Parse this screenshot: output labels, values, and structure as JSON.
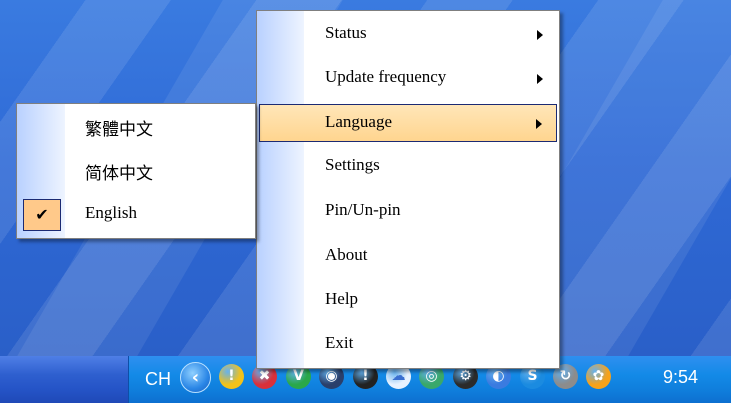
{
  "main_menu": {
    "items": [
      {
        "label": "Status",
        "has_submenu": true
      },
      {
        "label": "Update frequency",
        "has_submenu": true
      },
      {
        "label": "Language",
        "has_submenu": true,
        "highlighted": true
      },
      {
        "label": "Settings",
        "has_submenu": false
      },
      {
        "label": "Pin/Un-pin",
        "has_submenu": false
      },
      {
        "label": "About",
        "has_submenu": false
      },
      {
        "label": "Help",
        "has_submenu": false
      },
      {
        "label": "Exit",
        "has_submenu": false
      }
    ]
  },
  "language_menu": {
    "items": [
      {
        "label": "繁體中文",
        "checked": false
      },
      {
        "label": "简体中文",
        "checked": false
      },
      {
        "label": "English",
        "checked": true
      }
    ],
    "check_glyph": "✔"
  },
  "taskbar": {
    "language_indicator": "CH",
    "expand_arrow": "‹",
    "clock": "9:54",
    "tray_icons": [
      {
        "name": "shield-icon",
        "glyph": "!",
        "color": "#f2c21a"
      },
      {
        "name": "security-alert-icon",
        "glyph": "✖",
        "color": "#d9303a"
      },
      {
        "name": "vc-app-icon",
        "glyph": "V",
        "color": "#2aa84a"
      },
      {
        "name": "network-globe-icon",
        "glyph": "◉",
        "color": "#2a3f6b"
      },
      {
        "name": "info-icon",
        "glyph": "!",
        "color": "#222222"
      },
      {
        "name": "cloud-icon",
        "glyph": "☁",
        "color": "#e8f2ff"
      },
      {
        "name": "green-circle-icon",
        "glyph": "◎",
        "color": "#39a86a"
      },
      {
        "name": "gear-app-icon",
        "glyph": "⚙",
        "color": "#2b2b2b"
      },
      {
        "name": "globe-app-icon",
        "glyph": "◐",
        "color": "#3a7be0"
      },
      {
        "name": "skype-icon",
        "glyph": "S",
        "color": "#1b8be0"
      },
      {
        "name": "sync-icon",
        "glyph": "↻",
        "color": "#8c8c8c"
      },
      {
        "name": "msn-butterfly-icon",
        "glyph": "✿",
        "color": "#f7a21a"
      }
    ]
  }
}
